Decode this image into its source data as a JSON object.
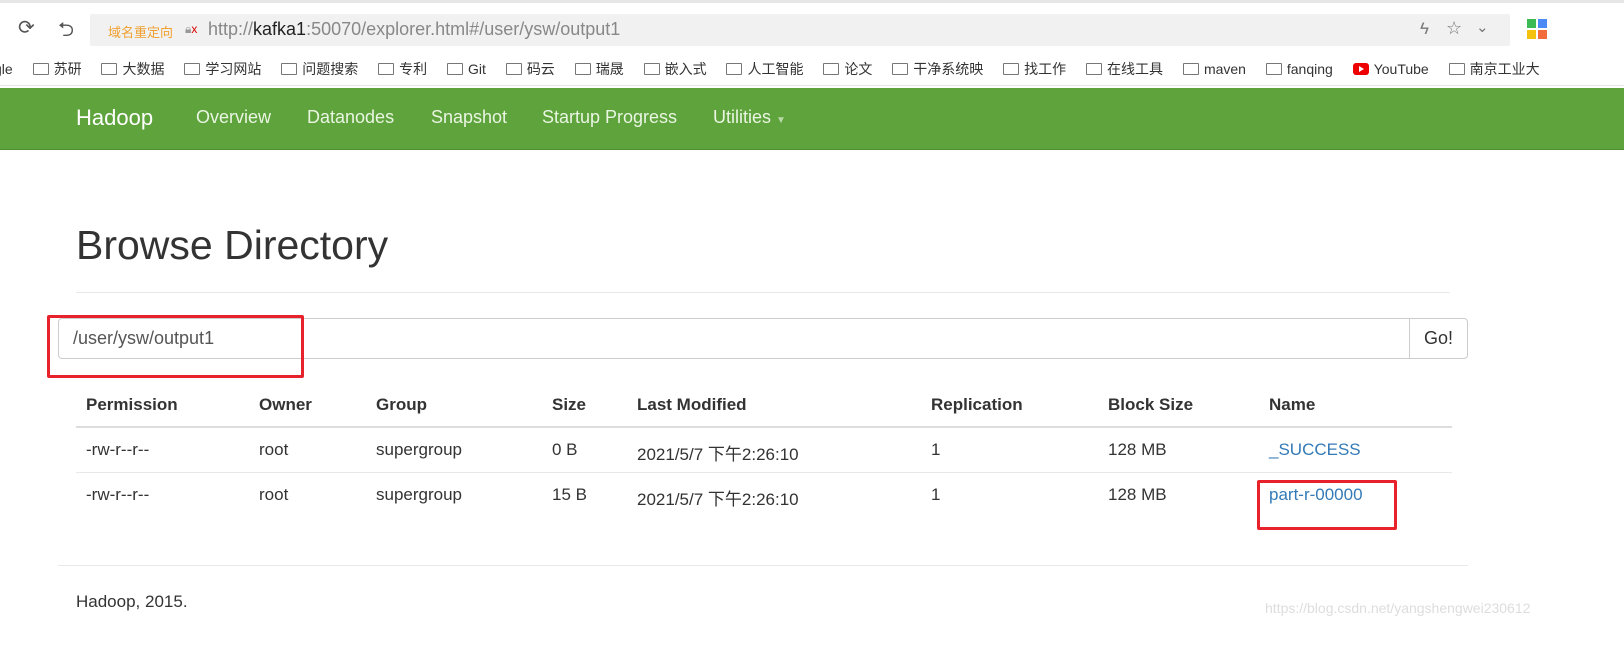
{
  "browser": {
    "redirect_label": "域名重定向",
    "url_prefix": "http://",
    "url_host": "kafka1",
    "url_rest": ":50070/explorer.html#/user/ysw/output1",
    "bookmarks": [
      "gle",
      "苏研",
      "大数据",
      "学习网站",
      "问题搜索",
      "专利",
      "Git",
      "码云",
      "瑞晟",
      "嵌入式",
      "人工智能",
      "论文",
      "干净系统映",
      "找工作",
      "在线工具",
      "maven",
      "fanqing",
      "YouTube",
      "南京工业大"
    ]
  },
  "navbar": {
    "brand": "Hadoop",
    "items": [
      "Overview",
      "Datanodes",
      "Snapshot",
      "Startup Progress",
      "Utilities"
    ],
    "color": "#5ea33c"
  },
  "page": {
    "title": "Browse Directory",
    "path_value": "/user/ysw/output1",
    "go_label": "Go!"
  },
  "table": {
    "headers": [
      "Permission",
      "Owner",
      "Group",
      "Size",
      "Last Modified",
      "Replication",
      "Block Size",
      "Name"
    ],
    "rows": [
      [
        "-rw-r--r--",
        "root",
        "supergroup",
        "0 B",
        "2021/5/7 下午2:26:10",
        "1",
        "128 MB",
        "_SUCCESS"
      ],
      [
        "-rw-r--r--",
        "root",
        "supergroup",
        "15 B",
        "2021/5/7 下午2:26:10",
        "1",
        "128 MB",
        "part-r-00000"
      ]
    ]
  },
  "footer": "Hadoop, 2015.",
  "watermark": "https://blog.csdn.net/yangshengwei230612",
  "highlight_color": "#e8222a"
}
